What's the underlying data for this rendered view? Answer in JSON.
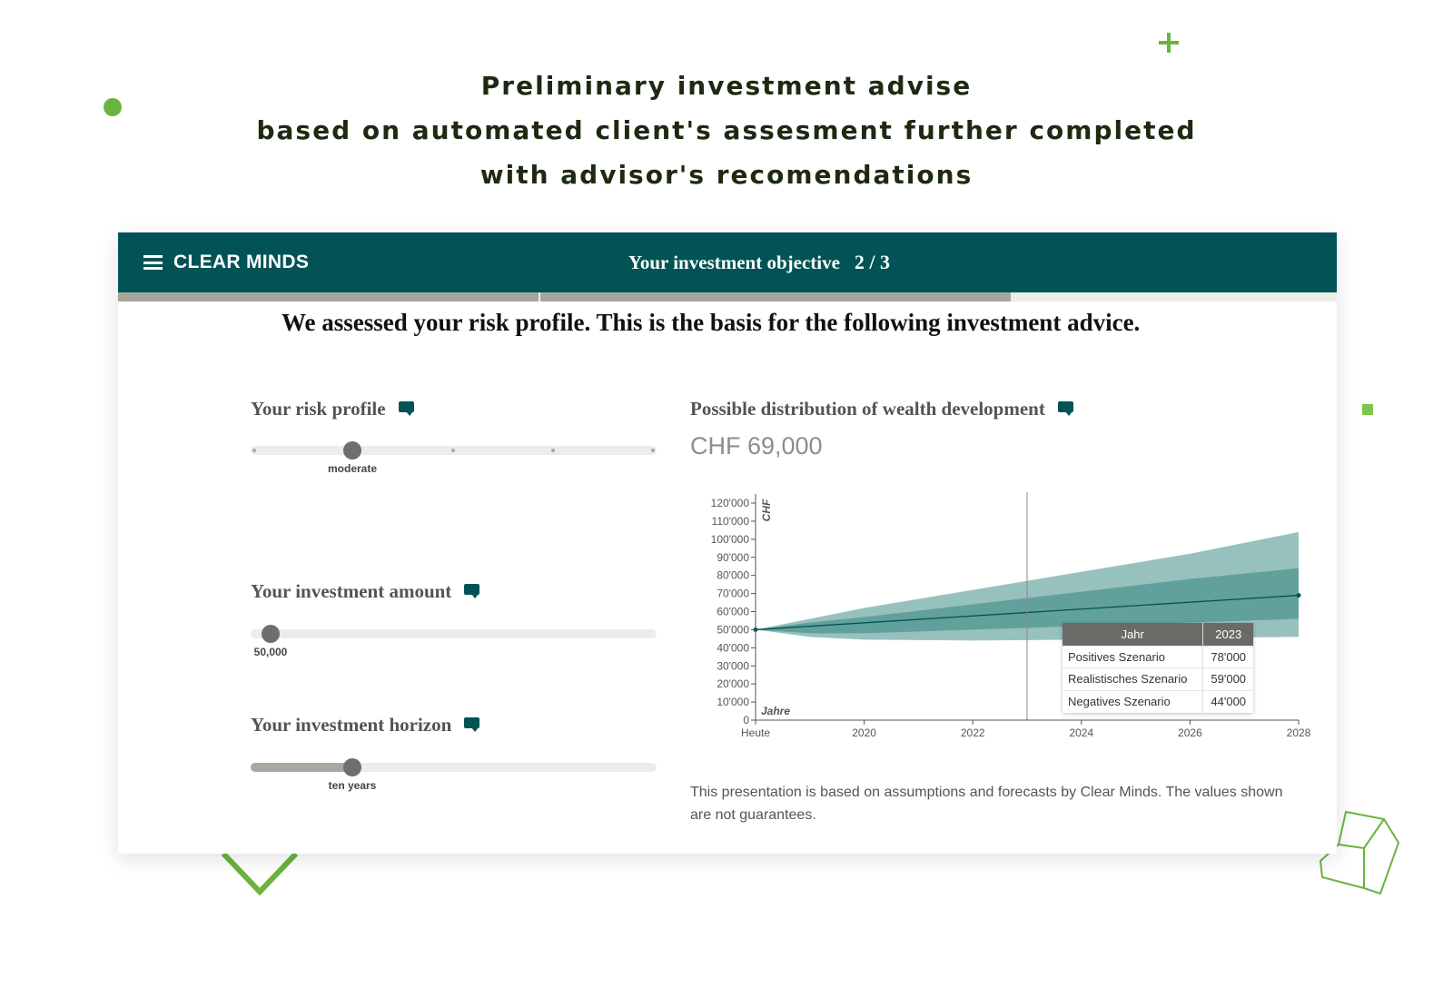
{
  "headline": {
    "line1": "Preliminary investment advise",
    "line2": "based on automated client's assesment further completed",
    "line3": "with advisor's recomendations"
  },
  "colors": {
    "brand": "#025355",
    "accent_green": "#6ab43e",
    "band_outer": "#97c1bd",
    "band_inner": "#62a09b"
  },
  "topbar": {
    "brand": "CLEAR MINDS",
    "step_title": "Your investment objective",
    "step_count": "2 / 3"
  },
  "main_heading": "We assessed your risk profile. This is the basis for the following investment advice.",
  "risk_profile": {
    "title": "Your risk profile",
    "value_label": "moderate",
    "level": 2,
    "levels": 5
  },
  "investment_amount": {
    "title": "Your investment amount",
    "value_label": "50,000",
    "fraction": 0.05
  },
  "investment_horizon": {
    "title": "Your investment horizon",
    "value_label": "ten years",
    "fraction": 0.25
  },
  "wealth": {
    "title": "Possible distribution of wealth development",
    "amount": "CHF 69,000",
    "disclaimer": "This presentation is based on assumptions and forecasts by Clear Minds. The values shown are not guarantees."
  },
  "tooltip": {
    "header_label": "Jahr",
    "header_value": "2023",
    "rows": [
      {
        "label": "Positives Szenario",
        "value": "78'000"
      },
      {
        "label": "Realistisches Szenario",
        "value": "59'000"
      },
      {
        "label": "Negatives Szenario",
        "value": "44'000"
      }
    ]
  },
  "chart_data": {
    "type": "area",
    "ylabel": "CHF",
    "xlabel": "Jahre",
    "x_ticks": [
      "Heute",
      "2020",
      "2022",
      "2024",
      "2026",
      "2028"
    ],
    "y_ticks": [
      "0",
      "10'000",
      "20'000",
      "30'000",
      "40'000",
      "50'000",
      "60'000",
      "70'000",
      "80'000",
      "90'000",
      "100'000",
      "110'000",
      "120'000"
    ],
    "ylim": [
      0,
      120000
    ],
    "xlim": [
      2018,
      2028
    ],
    "cursor_x": 2023,
    "series": [
      {
        "name": "Positives Szenario",
        "x": [
          2018,
          2019,
          2020,
          2022,
          2024,
          2026,
          2028
        ],
        "values": [
          50000,
          56000,
          62000,
          72000,
          82000,
          92000,
          104000
        ]
      },
      {
        "name": "Realistisches Szenario",
        "x": [
          2018,
          2028
        ],
        "values": [
          50000,
          69000
        ]
      },
      {
        "name": "Negatives Szenario",
        "x": [
          2018,
          2019,
          2020,
          2022,
          2024,
          2026,
          2028
        ],
        "values": [
          50000,
          46000,
          44500,
          44000,
          44500,
          45500,
          46000
        ]
      }
    ],
    "inner_band": {
      "upper": [
        50000,
        54000,
        57000,
        64000,
        71000,
        78000,
        84000
      ],
      "lower": [
        50000,
        48000,
        48000,
        50000,
        52000,
        54000,
        56000
      ]
    }
  }
}
